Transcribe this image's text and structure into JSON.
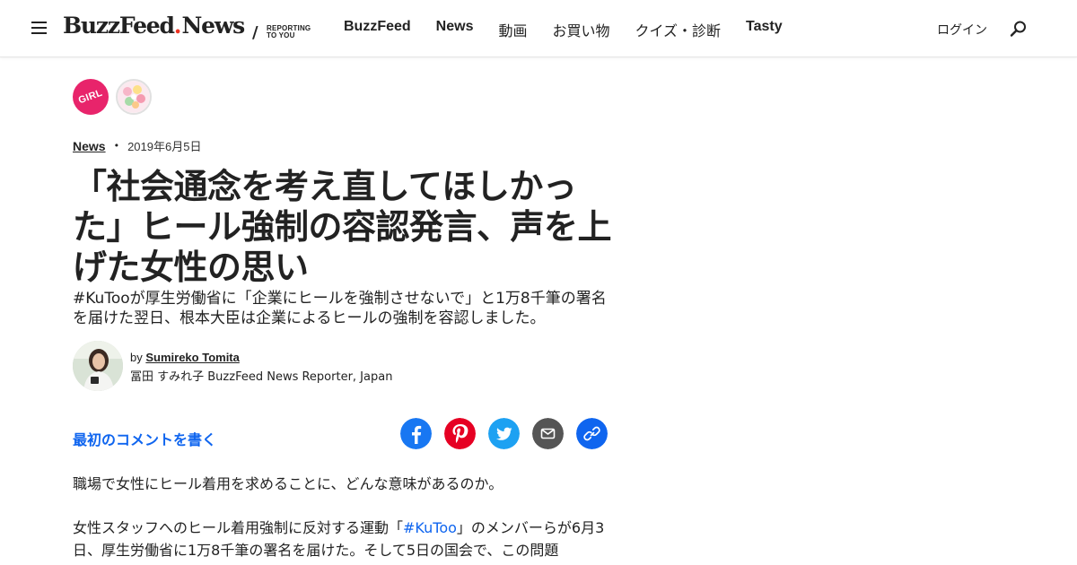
{
  "header": {
    "logo_buzz": "BuzzFeed",
    "logo_dot": ".",
    "logo_news": "News",
    "reporting_line1": "REPORTING",
    "reporting_line2": "TO YOU",
    "nav": [
      {
        "label": "BuzzFeed",
        "bold": true
      },
      {
        "label": "News",
        "bold": true
      },
      {
        "label": "動画",
        "bold": false
      },
      {
        "label": "お買い物",
        "bold": false
      },
      {
        "label": "クイズ・診断",
        "bold": false
      },
      {
        "label": "Tasty",
        "bold": true
      }
    ],
    "login": "ログイン"
  },
  "badges": {
    "girl_label": "GIRL"
  },
  "meta": {
    "category": "News",
    "separator": "•",
    "date": "2019年6月5日"
  },
  "article": {
    "title": "「社会通念を考え直してほしかった」ヒール強制の容認発言、声を上げた女性の思い",
    "dek": "#KuTooが厚生労働省に「企業にヒールを強制させないで」と1万8千筆の署名を届けた翌日、根本大臣は企業によるヒールの強制を容認しました。"
  },
  "byline": {
    "by": "by",
    "author": "Sumireko Tomita",
    "role": "冨田 すみれ子 BuzzFeed News Reporter, Japan"
  },
  "comments": {
    "icon_glyph": "",
    "label": "最初のコメントを書く"
  },
  "share": {
    "colors": {
      "facebook": "#1877f2",
      "pinterest": "#e60023",
      "twitter": "#1da1f2",
      "email": "#555555",
      "link": "#0f65ef"
    }
  },
  "body": {
    "p1": "職場で女性にヒール着用を求めることに、どんな意味があるのか。",
    "p2_before": "女性スタッフへのヒール着用強制に反対する運動「",
    "p2_link": "#KuToo",
    "p2_after": "」のメンバーらが6月3日、厚生労働省に1万8千筆の署名を届けた。そして5日の国会で、この問題"
  }
}
